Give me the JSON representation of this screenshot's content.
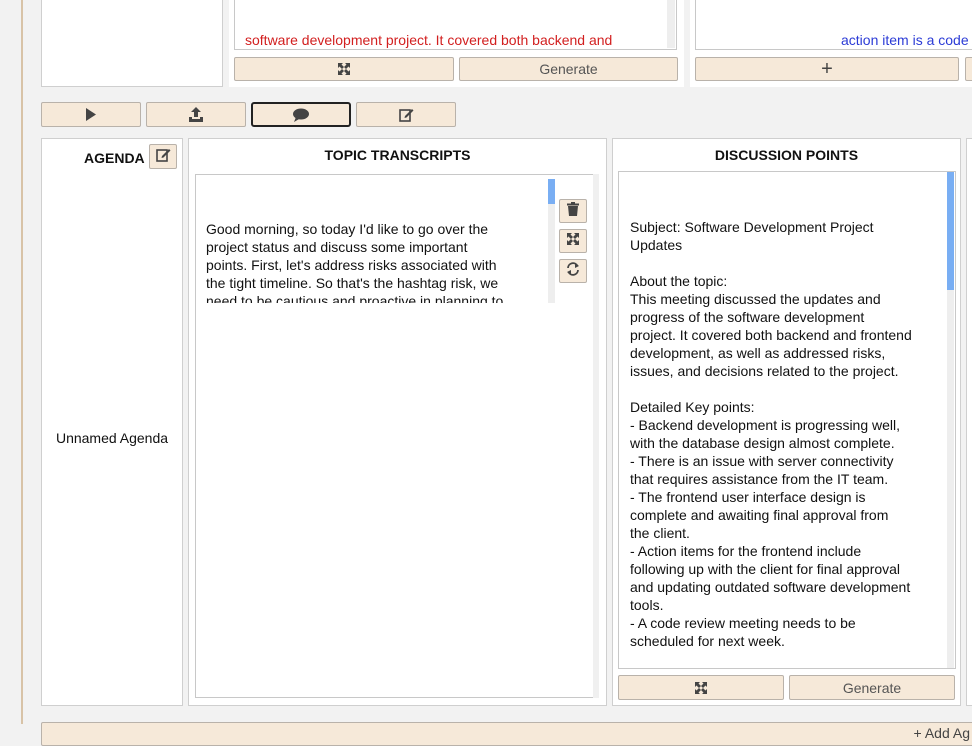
{
  "top": {
    "summary_text_red": "software development project. It covered both backend and\nfrontend development, as well as addressed risks, issues, and\ndecisions related to the project.",
    "generate_label": "Generate",
    "action_text_blue": "action item is a code\nto be scheduled for\nnow. thank you.",
    "add_label": "+"
  },
  "agenda": {
    "title": "AGENDA",
    "name": "Unnamed Agenda"
  },
  "transcripts": {
    "title": "TOPIC TRANSCRIPTS",
    "text": "Good morning, so today I'd like to go over the\nproject status and discuss some important\npoints. First, let's address risks associated with\nthe tight timeline. So that's the hashtag risk, we\nneed to be cautious and proactive in planning to\navoid potential delays due to the tight timeline.\nNow moving on to the hashtag assumption, we"
  },
  "discussion": {
    "title": "DISCUSSION POINTS",
    "text": "Subject: Software Development Project\nUpdates\n\nAbout the topic:\nThis meeting discussed the updates and\nprogress of the software development\nproject. It covered both backend and frontend\ndevelopment, as well as addressed risks,\nissues, and decisions related to the project.\n\nDetailed Key points:\n- Backend development is progressing well,\nwith the database design almost complete.\n- There is an issue with server connectivity\nthat requires assistance from the IT team.\n- The frontend user interface design is\ncomplete and awaiting final approval from\nthe client.\n- Action items for the frontend include\nfollowing up with the client for final approval\nand updating outdated software development\ntools.\n- A code review meeting needs to be\nscheduled for next week.\n\nRisks, Assumptions, Issues, Decisions:\n- Risk: The tight timeline poses a potential",
    "generate_label": "Generate"
  },
  "footer": {
    "add_agenda_label": "+ Add Ag"
  },
  "colors": {
    "button_bg": "#f6e9d9",
    "red_text": "#d21f1f",
    "blue_text": "#2b3bd6",
    "scroll_thumb": "#79aef3"
  },
  "icons": [
    "play-icon",
    "upload-icon",
    "chat-icon",
    "edit-icon",
    "expand-icon",
    "trash-icon",
    "refresh-icon",
    "plus-icon"
  ]
}
